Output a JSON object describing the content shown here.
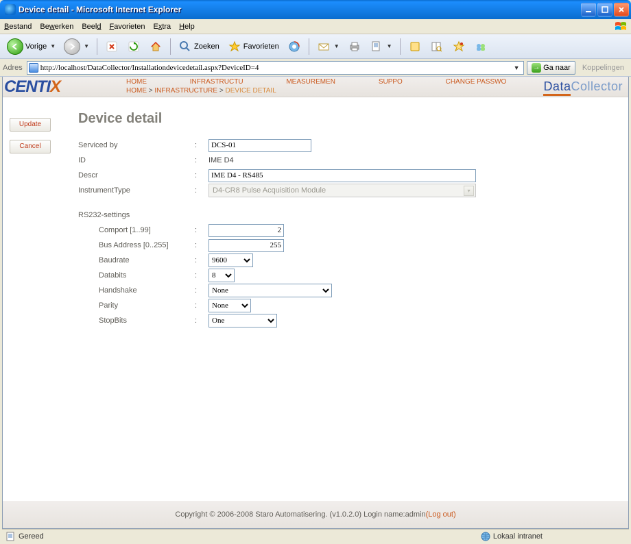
{
  "window": {
    "title": "Device detail - Microsoft Internet Explorer"
  },
  "menu": {
    "bestand": "Bestand",
    "bewerken": "Bewerken",
    "beeld": "Beeld",
    "favorieten": "Favorieten",
    "extra": "Extra",
    "help": "Help"
  },
  "toolbar": {
    "back": "Vorige",
    "search": "Zoeken",
    "favorites": "Favorieten"
  },
  "address": {
    "label": "Adres",
    "url": "http://localhost/DataCollector/Installationdevicedetail.aspx?DeviceID=4",
    "go": "Ga naar",
    "links": "Koppelingen"
  },
  "nav": {
    "home": "HOME",
    "infrastructure": "INFRASTRUCTURE",
    "infrastructure_short": "INFRASTRUCTU",
    "measurement": "MEASUREMEN",
    "support": "SUPPO",
    "change_password": "CHANGE PASSWO"
  },
  "breadcrumb": {
    "home": "HOME",
    "infrastructure": "INFRASTRUCTURE",
    "current": "DEVICE DETAIL"
  },
  "brand": {
    "logo_pre": "CENTI",
    "logo_x": "X",
    "app_pre": "Data",
    "app_suf": "Collector"
  },
  "buttons": {
    "update": "Update",
    "cancel": "Cancel"
  },
  "page": {
    "title": "Device detail"
  },
  "form": {
    "serviced_by": {
      "label": "Serviced by",
      "value": "DCS-01"
    },
    "id": {
      "label": "ID",
      "value": "IME D4"
    },
    "descr": {
      "label": "Descr",
      "value": "IME D4 - RS485"
    },
    "instrument_type": {
      "label": "InstrumentType",
      "value": "D4-CR8 Pulse Acquisition Module"
    },
    "rs232_section": "RS232-settings",
    "comport": {
      "label": "Comport [1..99]",
      "value": "2"
    },
    "bus_address": {
      "label": "Bus Address [0..255]",
      "value": "255"
    },
    "baudrate": {
      "label": "Baudrate",
      "value": "9600"
    },
    "databits": {
      "label": "Databits",
      "value": "8"
    },
    "handshake": {
      "label": "Handshake",
      "value": "None"
    },
    "parity": {
      "label": "Parity",
      "value": "None"
    },
    "stopbits": {
      "label": "StopBits",
      "value": "One"
    }
  },
  "footer": {
    "copyright": "Copyright © 2006-2008 Staro Automatisering. (v1.0.2.0) Login name:admin ",
    "logout": "(Log out)"
  },
  "status": {
    "ready": "Gereed",
    "zone": "Lokaal intranet"
  }
}
